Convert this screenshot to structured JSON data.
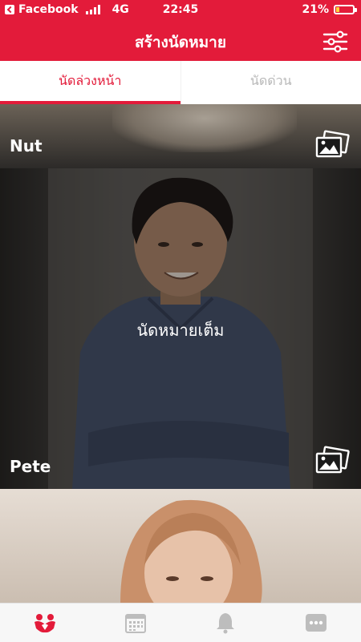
{
  "status_bar": {
    "back_app": "Facebook",
    "network": "4G",
    "time": "22:45",
    "battery_percent": "21%",
    "battery_level": 0.21
  },
  "header": {
    "title": "สร้างนัดหมาย",
    "filter_icon": "sliders-icon"
  },
  "tabs": [
    {
      "label": "นัดล่วงหน้า",
      "active": true
    },
    {
      "label": "นัดด่วน",
      "active": false
    }
  ],
  "cards": [
    {
      "name": "Nut",
      "photo_icon": "gallery-icon"
    },
    {
      "name": "Pete",
      "overlay_text": "นัดหมายเต็ม",
      "photo_icon": "gallery-icon"
    },
    {
      "name": ""
    }
  ],
  "bottom_nav": [
    {
      "icon": "people-heart-icon",
      "active": true
    },
    {
      "icon": "calendar-icon",
      "active": false
    },
    {
      "icon": "bell-icon",
      "active": false
    },
    {
      "icon": "more-icon",
      "active": false
    }
  ],
  "colors": {
    "brand": "#e31b3a",
    "inactive": "#bdbdbd"
  }
}
